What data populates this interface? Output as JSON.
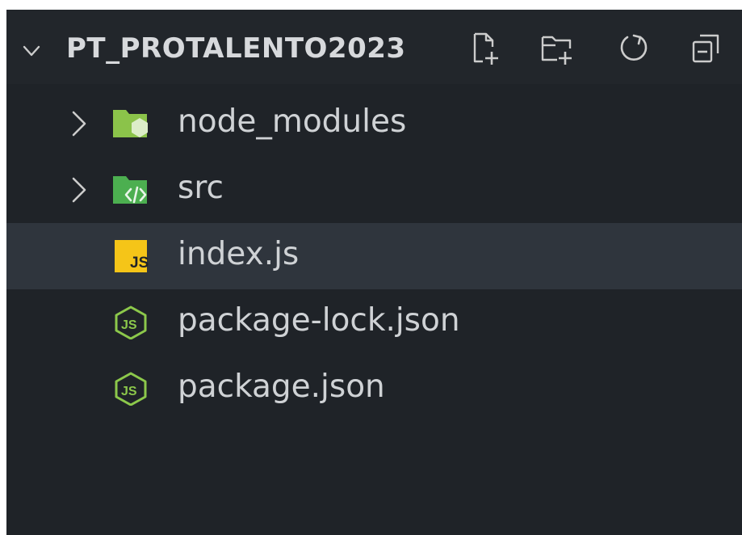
{
  "explorer": {
    "title": "PT_PROTALENTO2023",
    "actions": [
      {
        "icon": "new-file-icon"
      },
      {
        "icon": "new-folder-icon"
      },
      {
        "icon": "refresh-icon"
      },
      {
        "icon": "collapse-all-icon"
      }
    ],
    "items": [
      {
        "label": "node_modules",
        "type": "folder",
        "icon": "node-modules-folder-icon",
        "expanded": false
      },
      {
        "label": "src",
        "type": "folder",
        "icon": "src-folder-icon",
        "expanded": false
      },
      {
        "label": "index.js",
        "type": "file",
        "icon": "javascript-file-icon",
        "selected": true
      },
      {
        "label": "package-lock.json",
        "type": "file",
        "icon": "nodejs-file-icon"
      },
      {
        "label": "package.json",
        "type": "file",
        "icon": "nodejs-file-icon"
      }
    ]
  },
  "colors": {
    "background": "#1f2328",
    "header": "#22262b",
    "selected_row": "#2f353d",
    "folder_green": "#8bc34a",
    "js_yellow": "#f5c518",
    "node_green": "#8cc84b"
  }
}
